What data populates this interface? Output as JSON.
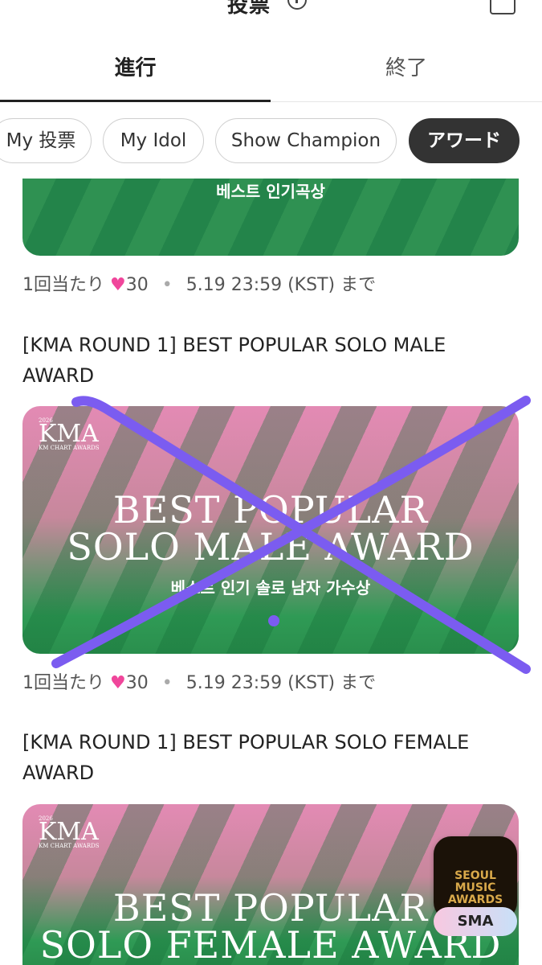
{
  "header": {
    "title": "投票"
  },
  "tabs": [
    {
      "label": "進行",
      "active": true
    },
    {
      "label": "終了",
      "active": false
    }
  ],
  "filters": [
    {
      "label": "My 投票",
      "active": false
    },
    {
      "label": "My Idol",
      "active": false
    },
    {
      "label": "Show Champion",
      "active": false
    },
    {
      "label": "アワード",
      "active": true
    }
  ],
  "items": [
    {
      "banner_subtitle": "베스트 인기곡상",
      "meta": {
        "per_vote": "1回当たり",
        "hearts": "30",
        "deadline": "5.19 23:59 (KST) まで"
      }
    },
    {
      "title": "[KMA ROUND 1] BEST POPULAR SOLO MALE AWARD",
      "banner_title_line1": "BEST POPULAR",
      "banner_title_line2": "SOLO MALE AWARD",
      "banner_subtitle": "베스트 인기 솔로 남자 가수상",
      "meta": {
        "per_vote": "1回当たり",
        "hearts": "30",
        "deadline": "5.19 23:59 (KST) まで"
      }
    },
    {
      "title": "[KMA ROUND 1] BEST POPULAR SOLO FEMALE AWARD",
      "banner_title_line1": "BEST POPULAR",
      "banner_title_line2": "SOLO FEMALE AWARD"
    }
  ],
  "kma_logo": {
    "big": "KMA",
    "year": "2026",
    "name": "KM CHART AWARDS"
  },
  "sma": {
    "logo_text": "SEOUL MUSIC AWARDS",
    "label": "SMA"
  },
  "colors": {
    "accent_heart": "#f0469b",
    "active_chip": "#333333",
    "banner_green": "#2f9152",
    "banner_pink": "#e38ab4",
    "annotation_purple": "#7b5cf0"
  }
}
